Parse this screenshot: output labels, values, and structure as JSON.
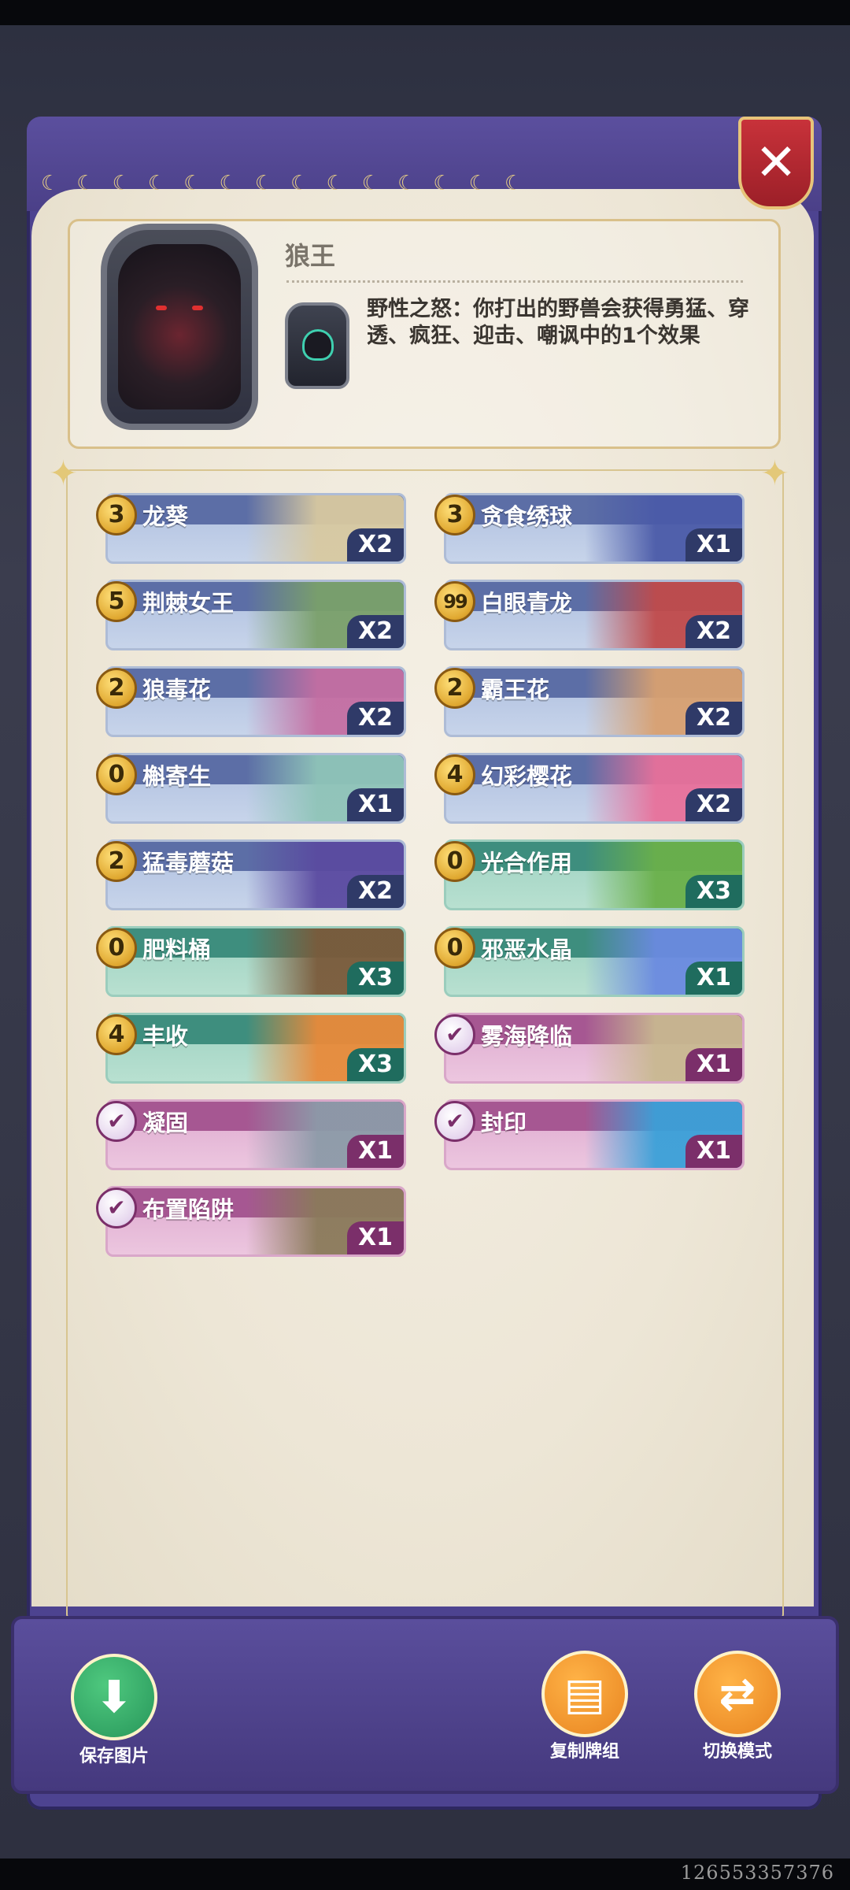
{
  "hero": {
    "name": "狼王",
    "skill_text": "野性之怒：你打出的野兽会获得勇猛、穿透、疯狂、迎击、嘲讽中的1个效果"
  },
  "close_label": "✕",
  "cards_left": [
    {
      "cost": "3",
      "name": "龙葵",
      "count": "X2",
      "type": "unit",
      "art": "#d8c9a0"
    },
    {
      "cost": "5",
      "name": "荆棘女王",
      "count": "X2",
      "type": "unit",
      "art": "#7aa06a"
    },
    {
      "cost": "2",
      "name": "狼毒花",
      "count": "X2",
      "type": "unit",
      "art": "#c46ea2"
    },
    {
      "cost": "0",
      "name": "槲寄生",
      "count": "X1",
      "type": "unit",
      "art": "#8fc4b8"
    },
    {
      "cost": "2",
      "name": "猛毒蘑菇",
      "count": "X2",
      "type": "unit",
      "art": "#5a4aa0"
    },
    {
      "cost": "0",
      "name": "肥料桶",
      "count": "X3",
      "type": "spell",
      "art": "#7a5a3a"
    },
    {
      "cost": "4",
      "name": "丰收",
      "count": "X3",
      "type": "spell",
      "art": "#e88a3a"
    },
    {
      "cost": "✔",
      "name": "凝固",
      "count": "X1",
      "type": "trap",
      "art": "#8c9aa8"
    },
    {
      "cost": "✔",
      "name": "布置陷阱",
      "count": "X1",
      "type": "trap",
      "art": "#8a7a5a"
    }
  ],
  "cards_right": [
    {
      "cost": "3",
      "name": "贪食绣球",
      "count": "X1",
      "type": "unit",
      "art": "#4a5aa8"
    },
    {
      "cost": "99",
      "name": "白眼青龙",
      "count": "X2",
      "type": "unit",
      "art": "#c04a4a"
    },
    {
      "cost": "2",
      "name": "霸王花",
      "count": "X2",
      "type": "unit",
      "art": "#d8a070"
    },
    {
      "cost": "4",
      "name": "幻彩樱花",
      "count": "X2",
      "type": "unit",
      "art": "#e8709a"
    },
    {
      "cost": "0",
      "name": "光合作用",
      "count": "X3",
      "type": "spell",
      "art": "#6ab04a"
    },
    {
      "cost": "0",
      "name": "邪恶水晶",
      "count": "X1",
      "type": "spell",
      "art": "#6a8ae0"
    },
    {
      "cost": "✔",
      "name": "雾海降临",
      "count": "X1",
      "type": "trap",
      "art": "#c8b890"
    },
    {
      "cost": "✔",
      "name": "封印",
      "count": "X1",
      "type": "trap",
      "art": "#3aa0d8"
    }
  ],
  "actions": {
    "save": {
      "label": "保存图片",
      "icon": "download-icon"
    },
    "copy": {
      "label": "复制牌组",
      "icon": "document-icon"
    },
    "switch": {
      "label": "切换模式",
      "icon": "swap-arrows-icon"
    }
  },
  "watermark": "126553357376"
}
